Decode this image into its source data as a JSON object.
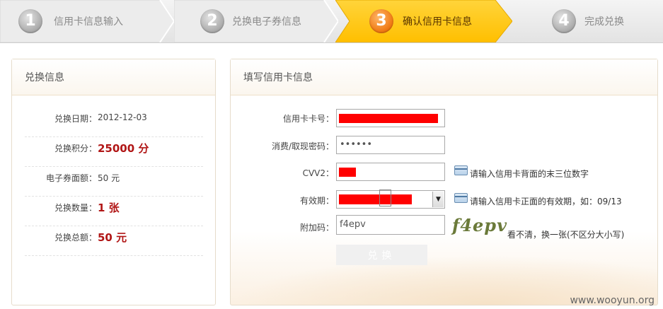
{
  "steps": [
    {
      "num": "1",
      "label": "信用卡信息输入",
      "state": "done"
    },
    {
      "num": "2",
      "label": "兑换电子券信息",
      "state": "done"
    },
    {
      "num": "3",
      "label": "确认信用卡信息",
      "state": "active"
    },
    {
      "num": "4",
      "label": "完成兑换",
      "state": "todo"
    }
  ],
  "colors": {
    "active_step": "#ffc60a",
    "highlight_value": "#b11616",
    "redaction": "#ff0000"
  },
  "left_panel": {
    "title": "兑换信息",
    "rows": [
      {
        "label": "兑换日期：",
        "value": "2012-12-03"
      },
      {
        "label": "兑换积分：",
        "value": "25000 分"
      },
      {
        "label": "电子券面额：",
        "value": "50 元"
      },
      {
        "label": "兑换数量：",
        "value": "1 张"
      },
      {
        "label": "兑换总额：",
        "value": "50 元"
      }
    ]
  },
  "form": {
    "title": "填写信用卡信息",
    "card_number_label": "信用卡卡号：",
    "password_label": "消费/取现密码：",
    "password_value": "••••••",
    "cvv_label": "CVV2：",
    "cvv_hint": "请输入信用卡背面的末三位数字",
    "expiry_label": "有效期：",
    "expiry_hint": "请输入信用卡正面的有效期，如：09/13",
    "captcha_label": "附加码：",
    "captcha_value": "f4epv",
    "captcha_image_text": "f4epv",
    "captcha_refresh": "看不清，换一张(不区分大小写)",
    "submit_label": "兑换"
  },
  "watermark": "www.wooyun.org"
}
